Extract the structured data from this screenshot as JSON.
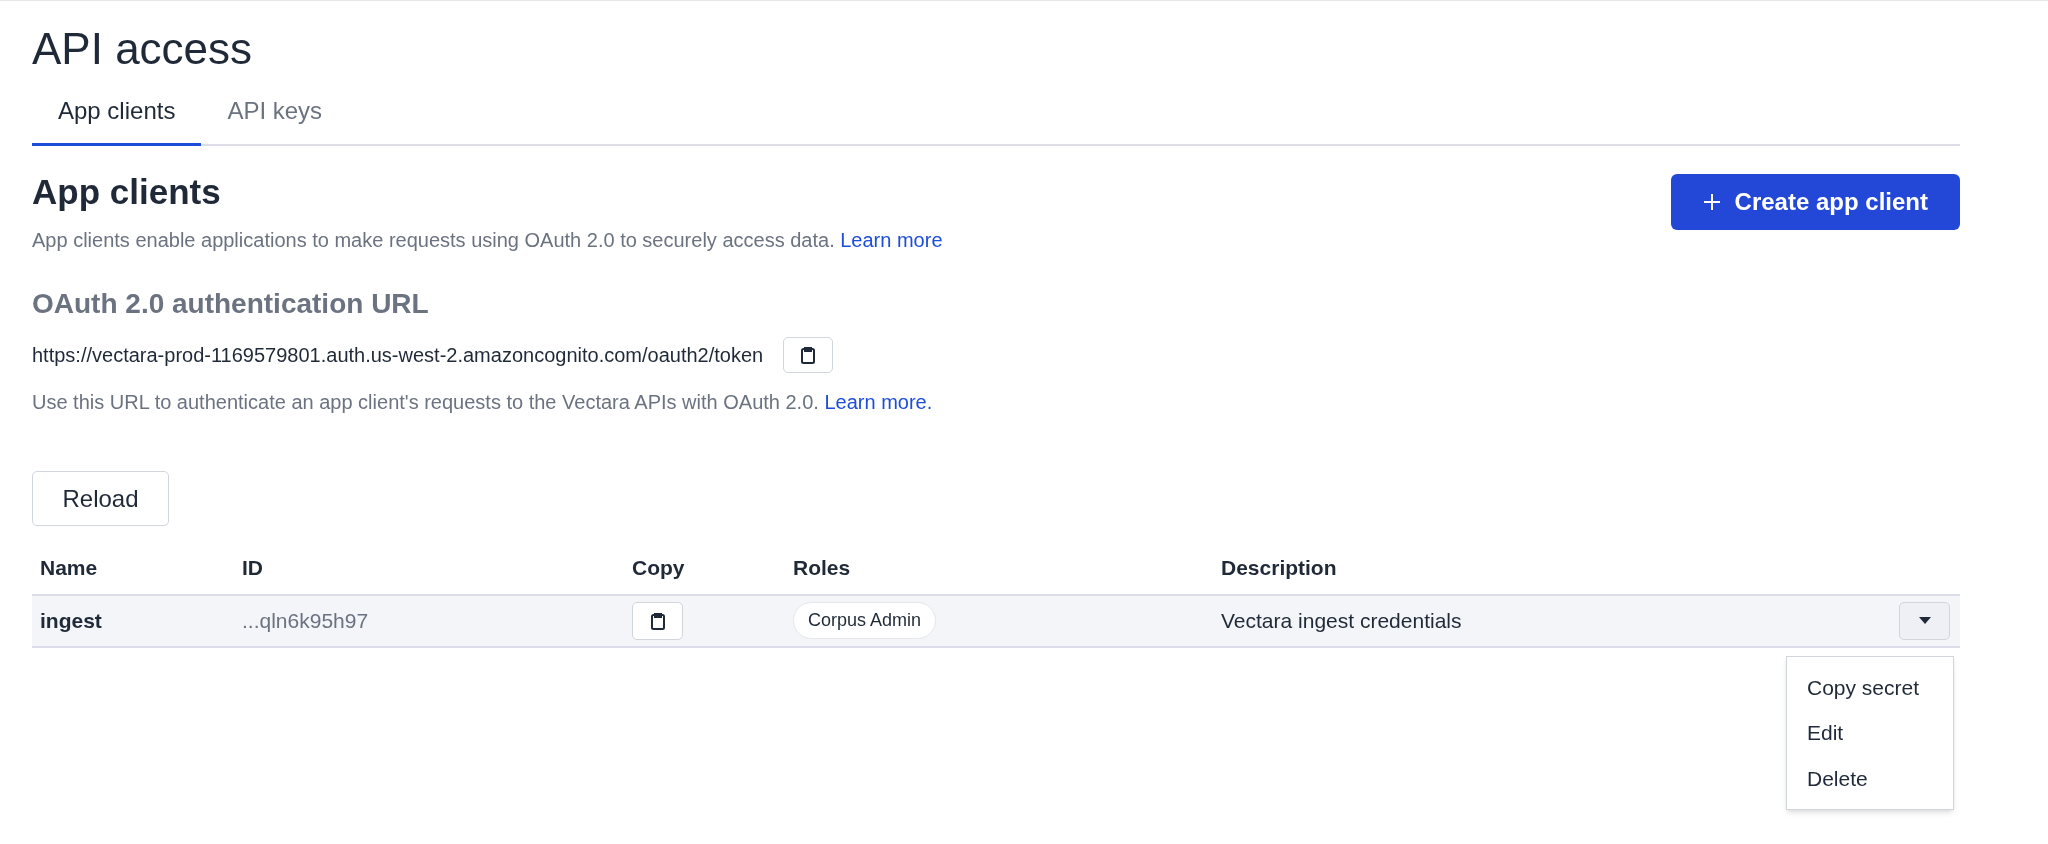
{
  "page": {
    "title": "API access"
  },
  "tabs": [
    {
      "label": "App clients",
      "selected": true
    },
    {
      "label": "API keys",
      "selected": false
    }
  ],
  "section": {
    "title": "App clients",
    "description": "App clients enable applications to make requests using OAuth 2.0 to securely access data.",
    "link": "Learn more",
    "create_button": "Create app client"
  },
  "oauth": {
    "title": "OAuth 2.0 authentication URL",
    "url": "https://vectara-prod-1169579801.auth.us-west-2.amazoncognito.com/oauth2/token",
    "help": "Use this URL to authenticate an app client's requests to the Vectara APIs with OAuth 2.0.",
    "link": "Learn more."
  },
  "reload_button": "Reload",
  "table": {
    "columns": [
      "Name",
      "ID",
      "Copy",
      "Roles",
      "Description"
    ],
    "rows": [
      {
        "name": "ingest",
        "id": "...qln6k95h97",
        "roles": [
          "Corpus Admin"
        ],
        "description": "Vectara ingest credentials",
        "menu_open": true
      }
    ]
  },
  "menu": {
    "items": [
      "Copy secret",
      "Edit",
      "Delete"
    ]
  }
}
